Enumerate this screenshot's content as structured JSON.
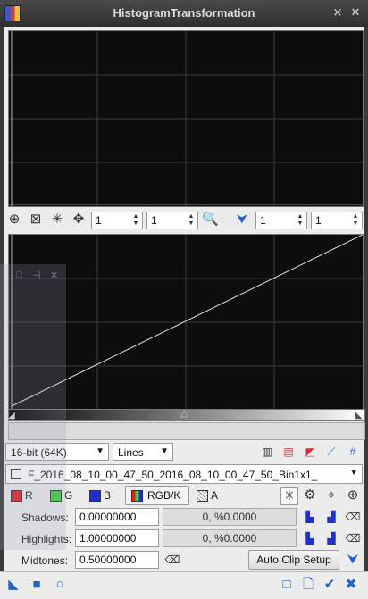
{
  "window": {
    "title": "HistogramTransformation"
  },
  "top_tools": {
    "zoom_x": "1",
    "zoom_y": "1",
    "bottom_zoom_x": "1",
    "bottom_zoom_y": "1"
  },
  "graph_controls": {
    "bit_depth": "16-bit (64K)",
    "graph_style": "Lines"
  },
  "view": {
    "selected": "F_2016_08_10_00_47_50_2016_08_10_00_47_50_Bin1x1_"
  },
  "channels": {
    "r": "R",
    "g": "G",
    "b": "B",
    "rgbk": "RGB/K",
    "a": "A"
  },
  "fields": {
    "shadows_label": "Shadows:",
    "shadows_value": "0.00000000",
    "shadows_clip": "0, %0.0000",
    "highlights_label": "Highlights:",
    "highlights_value": "1.00000000",
    "highlights_clip": "0, %0.0000",
    "midtones_label": "Midtones:",
    "midtones_value": "0.50000000"
  },
  "buttons": {
    "auto_clip": "Auto Clip Setup"
  },
  "colors": {
    "accent": "#1e63d4",
    "graph_bg": "#0d0d0d"
  }
}
